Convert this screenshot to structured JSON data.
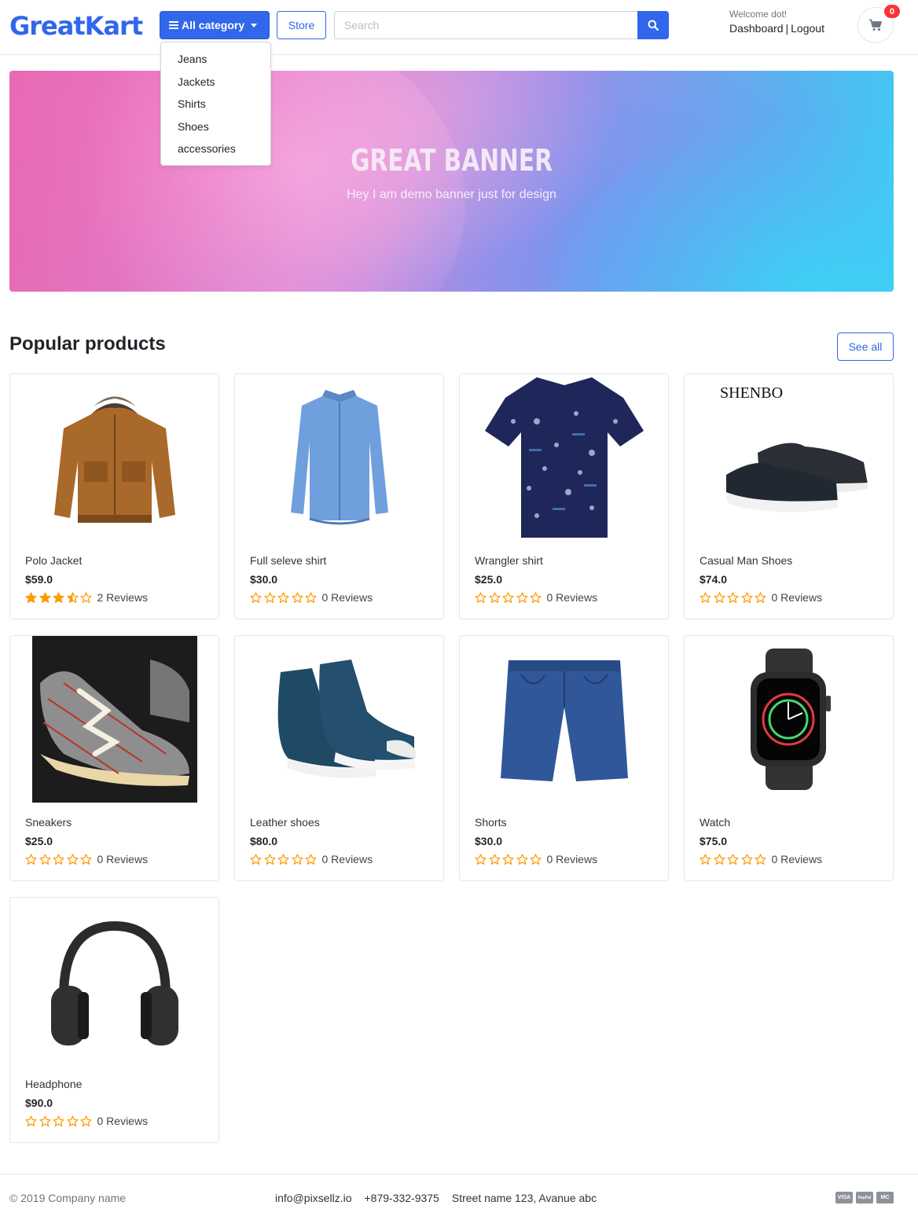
{
  "header": {
    "logo": "GreatKart",
    "category_button": "All category",
    "store_button": "Store",
    "search_placeholder": "Search",
    "welcome": "Welcome dot!",
    "dashboard": "Dashboard",
    "separator": "|",
    "logout": "Logout",
    "cart_count": "0"
  },
  "categories": [
    "Jeans",
    "Jackets",
    "Shirts",
    "Shoes",
    "accessories"
  ],
  "banner": {
    "title": "GREAT BANNER",
    "subtitle": "Hey I am demo banner just for design"
  },
  "section": {
    "title": "Popular products",
    "see_all": "See all"
  },
  "products": [
    {
      "name": "Polo Jacket",
      "price": "$59.0",
      "rating": 3.5,
      "reviews": "2 Reviews",
      "icon": "jacket-image"
    },
    {
      "name": "Full seleve shirt",
      "price": "$30.0",
      "rating": 0,
      "reviews": "0 Reviews",
      "icon": "shirt-image"
    },
    {
      "name": "Wrangler shirt",
      "price": "$25.0",
      "rating": 0,
      "reviews": "0 Reviews",
      "icon": "printed-shirt-image"
    },
    {
      "name": "Casual Man Shoes",
      "price": "$74.0",
      "rating": 0,
      "reviews": "0 Reviews",
      "icon": "shoes-image",
      "brand": "SHENBO"
    },
    {
      "name": "Sneakers",
      "price": "$25.0",
      "rating": 0,
      "reviews": "0 Reviews",
      "icon": "sneakers-image"
    },
    {
      "name": "Leather shoes",
      "price": "$80.0",
      "rating": 0,
      "reviews": "0 Reviews",
      "icon": "leather-shoes-image"
    },
    {
      "name": "Shorts",
      "price": "$30.0",
      "rating": 0,
      "reviews": "0 Reviews",
      "icon": "shorts-image"
    },
    {
      "name": "Watch",
      "price": "$75.0",
      "rating": 0,
      "reviews": "0 Reviews",
      "icon": "watch-image"
    },
    {
      "name": "Headphone",
      "price": "$90.0",
      "rating": 0,
      "reviews": "0 Reviews",
      "icon": "headphone-image"
    }
  ],
  "footer": {
    "copyright": "© 2019 Company name",
    "email": "info@pixsellz.io",
    "phone": "+879-332-9375",
    "address": "Street name 123, Avanue abc",
    "payments": [
      "VISA",
      "PayPal",
      "MC"
    ]
  },
  "colors": {
    "primary": "#3167eb",
    "star": "#ff9900",
    "badge": "#fa3434"
  }
}
